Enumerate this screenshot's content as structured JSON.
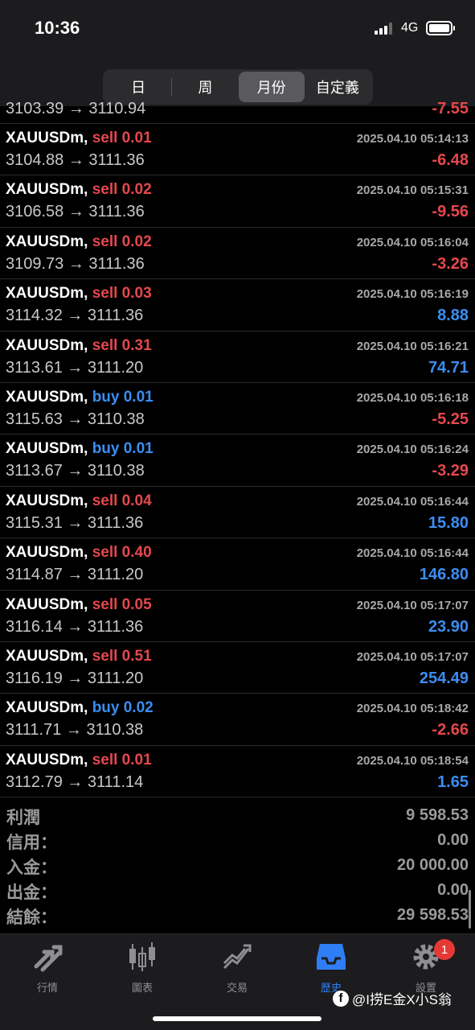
{
  "status_bar": {
    "time": "10:36",
    "network": "4G"
  },
  "period_tabs": [
    {
      "label": "日",
      "active": false
    },
    {
      "label": "周",
      "active": false
    },
    {
      "label": "月份",
      "active": true
    },
    {
      "label": "自定義",
      "active": false
    }
  ],
  "partial_row": {
    "prices": "3103.39 → 3110.94",
    "profit": "-7.55",
    "profit_sign": "neg"
  },
  "trades": [
    {
      "symbol": "XAUUSDm,",
      "type": "sell 0.01",
      "side": "sell",
      "datetime": "2025.04.10 05:14:13",
      "prices": "3104.88 → 3111.36",
      "profit": "-6.48",
      "profit_sign": "neg"
    },
    {
      "symbol": "XAUUSDm,",
      "type": "sell 0.02",
      "side": "sell",
      "datetime": "2025.04.10 05:15:31",
      "prices": "3106.58 → 3111.36",
      "profit": "-9.56",
      "profit_sign": "neg"
    },
    {
      "symbol": "XAUUSDm,",
      "type": "sell 0.02",
      "side": "sell",
      "datetime": "2025.04.10 05:16:04",
      "prices": "3109.73 → 3111.36",
      "profit": "-3.26",
      "profit_sign": "neg"
    },
    {
      "symbol": "XAUUSDm,",
      "type": "sell 0.03",
      "side": "sell",
      "datetime": "2025.04.10 05:16:19",
      "prices": "3114.32 → 3111.36",
      "profit": "8.88",
      "profit_sign": "pos"
    },
    {
      "symbol": "XAUUSDm,",
      "type": "sell 0.31",
      "side": "sell",
      "datetime": "2025.04.10 05:16:21",
      "prices": "3113.61 → 3111.20",
      "profit": "74.71",
      "profit_sign": "pos"
    },
    {
      "symbol": "XAUUSDm,",
      "type": "buy 0.01",
      "side": "buy",
      "datetime": "2025.04.10 05:16:18",
      "prices": "3115.63 → 3110.38",
      "profit": "-5.25",
      "profit_sign": "neg"
    },
    {
      "symbol": "XAUUSDm,",
      "type": "buy 0.01",
      "side": "buy",
      "datetime": "2025.04.10 05:16:24",
      "prices": "3113.67 → 3110.38",
      "profit": "-3.29",
      "profit_sign": "neg"
    },
    {
      "symbol": "XAUUSDm,",
      "type": "sell 0.04",
      "side": "sell",
      "datetime": "2025.04.10 05:16:44",
      "prices": "3115.31 → 3111.36",
      "profit": "15.80",
      "profit_sign": "pos"
    },
    {
      "symbol": "XAUUSDm,",
      "type": "sell 0.40",
      "side": "sell",
      "datetime": "2025.04.10 05:16:44",
      "prices": "3114.87 → 3111.20",
      "profit": "146.80",
      "profit_sign": "pos"
    },
    {
      "symbol": "XAUUSDm,",
      "type": "sell 0.05",
      "side": "sell",
      "datetime": "2025.04.10 05:17:07",
      "prices": "3116.14 → 3111.36",
      "profit": "23.90",
      "profit_sign": "pos"
    },
    {
      "symbol": "XAUUSDm,",
      "type": "sell 0.51",
      "side": "sell",
      "datetime": "2025.04.10 05:17:07",
      "prices": "3116.19 → 3111.20",
      "profit": "254.49",
      "profit_sign": "pos"
    },
    {
      "symbol": "XAUUSDm,",
      "type": "buy 0.02",
      "side": "buy",
      "datetime": "2025.04.10 05:18:42",
      "prices": "3111.71 → 3110.38",
      "profit": "-2.66",
      "profit_sign": "neg"
    },
    {
      "symbol": "XAUUSDm,",
      "type": "sell 0.01",
      "side": "sell",
      "datetime": "2025.04.10 05:18:54",
      "prices": "3112.79 → 3111.14",
      "profit": "1.65",
      "profit_sign": "pos"
    }
  ],
  "summary": [
    {
      "label": "利潤",
      "value": "9 598.53"
    },
    {
      "label": "信用：",
      "value": "0.00"
    },
    {
      "label": "入金：",
      "value": "20 000.00"
    },
    {
      "label": "出金：",
      "value": "0.00"
    },
    {
      "label": "結餘：",
      "value": "29 598.53"
    }
  ],
  "tabbar": [
    {
      "label": "行情",
      "icon": "quotes-arrows-icon",
      "active": false
    },
    {
      "label": "圖表",
      "icon": "candlestick-chart-icon",
      "active": false
    },
    {
      "label": "交易",
      "icon": "trade-chart-icon",
      "active": false
    },
    {
      "label": "歷史",
      "icon": "history-tray-icon",
      "active": true
    },
    {
      "label": "設置",
      "icon": "gear-icon",
      "active": false,
      "badge": "1"
    }
  ],
  "watermark": {
    "text": "@I捞E金X小S翁"
  },
  "colors": {
    "sell": "#e5484d",
    "buy": "#3b8ef0",
    "active_tab": "#2f7ef5"
  }
}
